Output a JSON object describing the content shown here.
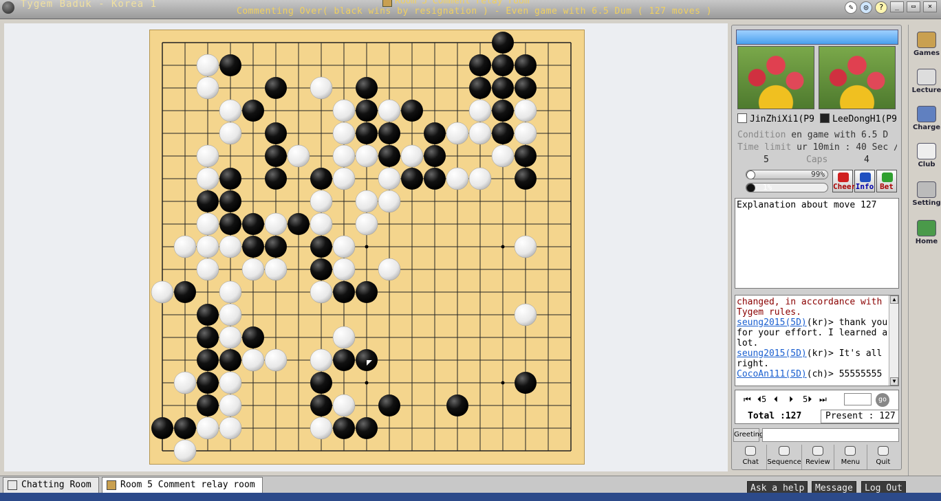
{
  "window": {
    "app_title": "Tygem Baduk - Korea 1",
    "room_title": "Room 5 Comment relay room",
    "status_line": "Commenting Over( black wins by resignation ) - Even game with 6.5 Dum  ( 127 moves )"
  },
  "players": {
    "white": {
      "name": "JinZhiXi1(P9"
    },
    "black": {
      "name": "LeeDongH1(P9"
    }
  },
  "game_info": {
    "condition_label": "Condition",
    "condition_value": "en game with 6.5 D",
    "time_label": "Time limit",
    "time_value": "ur 10min : 40 Sec /",
    "caps_label": "Caps",
    "white_caps": "5",
    "black_caps": "4",
    "white_pct": 99,
    "white_pct_label": "99%",
    "black_pct": 1,
    "black_pct_label": "1%",
    "buttons": {
      "cheer": "Cheer",
      "info": "Info",
      "bet": "Bet"
    }
  },
  "explanation": "Explanation about move 127",
  "chat": [
    {
      "user": "",
      "country": "",
      "text": "changed, in accordance with Tygem rules.",
      "system": true
    },
    {
      "user": "seung2015(5D)",
      "country": "(kr)",
      "text": "> thank you for your effort. I learned a lot."
    },
    {
      "user": "seung2015(5D)",
      "country": "(kr)",
      "text": "> It's all right."
    },
    {
      "user": "CocoAn111(5D)",
      "country": "(ch)",
      "text": "> 55555555"
    }
  ],
  "navigation": {
    "first": "⏮",
    "back5": "⏴5",
    "prev": "⏴",
    "next": "⏵",
    "fwd5": "5⏵",
    "last": "⏭",
    "go_label": "go",
    "total_label": "Total :127",
    "present_label": "Present : 127"
  },
  "greeting_label": "Greeting",
  "tools": [
    "Chat",
    "Sequence",
    "Review",
    "Menu",
    "Quit"
  ],
  "right_menu": [
    "Games",
    "Lecture",
    "Charge",
    "Club",
    "Setting",
    "Home"
  ],
  "bottom_tabs": [
    "Chatting Room",
    "Room 5 Comment relay room"
  ],
  "bottom_buttons": [
    "Ask a help",
    "Message",
    "Log Out"
  ],
  "board": {
    "size": 19,
    "hoshi": [
      [
        3,
        3
      ],
      [
        9,
        3
      ],
      [
        15,
        3
      ],
      [
        3,
        9
      ],
      [
        9,
        9
      ],
      [
        15,
        9
      ],
      [
        3,
        15
      ],
      [
        9,
        15
      ],
      [
        15,
        15
      ]
    ],
    "last_move": [
      9,
      14
    ],
    "black_stones": [
      [
        15,
        0
      ],
      [
        3,
        1
      ],
      [
        14,
        1
      ],
      [
        15,
        1
      ],
      [
        16,
        1
      ],
      [
        5,
        2
      ],
      [
        9,
        2
      ],
      [
        14,
        2
      ],
      [
        15,
        2
      ],
      [
        16,
        2
      ],
      [
        4,
        3
      ],
      [
        9,
        3
      ],
      [
        11,
        3
      ],
      [
        15,
        3
      ],
      [
        5,
        4
      ],
      [
        9,
        4
      ],
      [
        10,
        4
      ],
      [
        12,
        4
      ],
      [
        15,
        4
      ],
      [
        5,
        5
      ],
      [
        10,
        5
      ],
      [
        12,
        5
      ],
      [
        16,
        5
      ],
      [
        3,
        6
      ],
      [
        5,
        6
      ],
      [
        7,
        6
      ],
      [
        11,
        6
      ],
      [
        12,
        6
      ],
      [
        16,
        6
      ],
      [
        2,
        7
      ],
      [
        3,
        7
      ],
      [
        3,
        8
      ],
      [
        4,
        8
      ],
      [
        6,
        8
      ],
      [
        4,
        9
      ],
      [
        5,
        9
      ],
      [
        7,
        9
      ],
      [
        7,
        10
      ],
      [
        1,
        11
      ],
      [
        8,
        11
      ],
      [
        9,
        11
      ],
      [
        2,
        12
      ],
      [
        2,
        13
      ],
      [
        4,
        13
      ],
      [
        2,
        14
      ],
      [
        3,
        14
      ],
      [
        8,
        14
      ],
      [
        9,
        14
      ],
      [
        2,
        15
      ],
      [
        7,
        15
      ],
      [
        16,
        15
      ],
      [
        2,
        16
      ],
      [
        7,
        16
      ],
      [
        10,
        16
      ],
      [
        13,
        16
      ],
      [
        0,
        17
      ],
      [
        1,
        17
      ],
      [
        8,
        17
      ],
      [
        9,
        17
      ]
    ],
    "white_stones": [
      [
        2,
        1
      ],
      [
        2,
        2
      ],
      [
        7,
        2
      ],
      [
        3,
        3
      ],
      [
        8,
        3
      ],
      [
        10,
        3
      ],
      [
        14,
        3
      ],
      [
        16,
        3
      ],
      [
        3,
        4
      ],
      [
        8,
        4
      ],
      [
        13,
        4
      ],
      [
        14,
        4
      ],
      [
        16,
        4
      ],
      [
        2,
        5
      ],
      [
        6,
        5
      ],
      [
        8,
        5
      ],
      [
        9,
        5
      ],
      [
        11,
        5
      ],
      [
        15,
        5
      ],
      [
        2,
        6
      ],
      [
        8,
        6
      ],
      [
        10,
        6
      ],
      [
        13,
        6
      ],
      [
        14,
        6
      ],
      [
        7,
        7
      ],
      [
        9,
        7
      ],
      [
        10,
        7
      ],
      [
        2,
        8
      ],
      [
        5,
        8
      ],
      [
        7,
        8
      ],
      [
        9,
        8
      ],
      [
        1,
        9
      ],
      [
        2,
        9
      ],
      [
        3,
        9
      ],
      [
        8,
        9
      ],
      [
        16,
        9
      ],
      [
        2,
        10
      ],
      [
        4,
        10
      ],
      [
        5,
        10
      ],
      [
        8,
        10
      ],
      [
        10,
        10
      ],
      [
        0,
        11
      ],
      [
        3,
        11
      ],
      [
        7,
        11
      ],
      [
        3,
        12
      ],
      [
        16,
        12
      ],
      [
        3,
        13
      ],
      [
        8,
        13
      ],
      [
        4,
        14
      ],
      [
        5,
        14
      ],
      [
        7,
        14
      ],
      [
        1,
        15
      ],
      [
        3,
        15
      ],
      [
        3,
        16
      ],
      [
        8,
        16
      ],
      [
        2,
        17
      ],
      [
        3,
        17
      ],
      [
        7,
        17
      ],
      [
        1,
        18
      ]
    ]
  }
}
